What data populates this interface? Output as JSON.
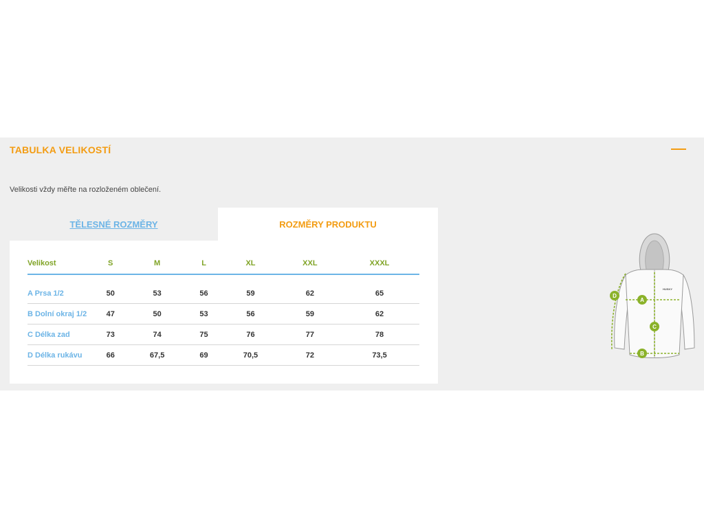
{
  "section": {
    "title": "TABULKA VELIKOSTÍ",
    "hint": "Velikosti vždy měřte na rozloženém oblečení."
  },
  "tabs": [
    {
      "label": "TĚLESNÉ ROZMĚRY",
      "active": false
    },
    {
      "label": "ROZMĚRY PRODUKTU",
      "active": true
    }
  ],
  "table": {
    "headers": [
      "Velikost",
      "S",
      "M",
      "L",
      "XL",
      "XXL",
      "XXXL"
    ],
    "rows": [
      {
        "label": "A Prsa 1/2",
        "values": [
          "50",
          "53",
          "56",
          "59",
          "62",
          "65"
        ]
      },
      {
        "label": "B Dolní okraj 1/2",
        "values": [
          "47",
          "50",
          "53",
          "56",
          "59",
          "62"
        ]
      },
      {
        "label": "C Délka zad",
        "values": [
          "73",
          "74",
          "75",
          "76",
          "77",
          "78"
        ]
      },
      {
        "label": "D Délka rukávu",
        "values": [
          "66",
          "67,5",
          "69",
          "70,5",
          "72",
          "73,5"
        ]
      }
    ]
  },
  "illustration": {
    "markers": [
      "A",
      "B",
      "C",
      "D"
    ],
    "brand": "HUSKY"
  },
  "colors": {
    "accent_orange": "#f39c12",
    "label_blue": "#6cb4e6",
    "header_green": "#7fa325",
    "marker_green": "#8bb22a"
  }
}
